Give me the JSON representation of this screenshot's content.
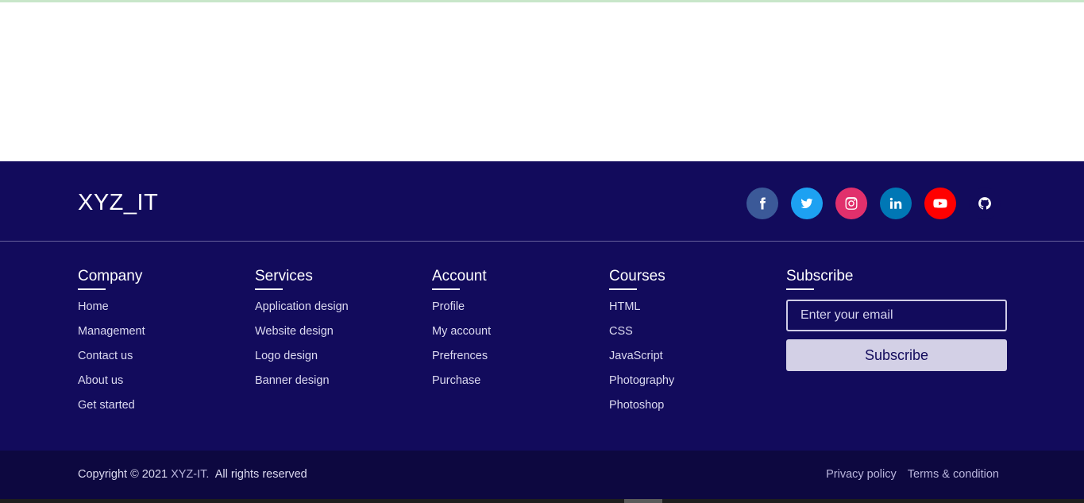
{
  "brand": "XYZ_IT",
  "socials": [
    {
      "name": "facebook",
      "color": "#3b5998"
    },
    {
      "name": "twitter",
      "color": "#1da1f2"
    },
    {
      "name": "instagram",
      "color": "#e1306c"
    },
    {
      "name": "linkedin",
      "color": "#0077b5"
    },
    {
      "name": "youtube",
      "color": "#ff0000"
    },
    {
      "name": "github",
      "color": "#120b5c"
    }
  ],
  "columns": [
    {
      "title": "Company",
      "items": [
        "Home",
        "Management",
        "Contact us",
        "About us",
        "Get started"
      ]
    },
    {
      "title": "Services",
      "items": [
        "Application design",
        "Website design",
        "Logo design",
        "Banner design"
      ]
    },
    {
      "title": "Account",
      "items": [
        "Profile",
        "My account",
        "Prefrences",
        "Purchase"
      ]
    },
    {
      "title": "Courses",
      "items": [
        "HTML",
        "CSS",
        "JavaScript",
        "Photography",
        "Photoshop"
      ]
    }
  ],
  "subscribe": {
    "title": "Subscribe",
    "placeholder": "Enter your email",
    "button": "Subscribe"
  },
  "bottom": {
    "copyright_prefix": "Copyright © 2021",
    "copyright_brand": "XYZ-IT.",
    "copyright_suffix": "All rights reserved",
    "privacy": "Privacy policy",
    "terms": "Terms & condition"
  },
  "colors": {
    "footer_bg": "#120b5c",
    "bottom_bg": "#0d0840"
  }
}
